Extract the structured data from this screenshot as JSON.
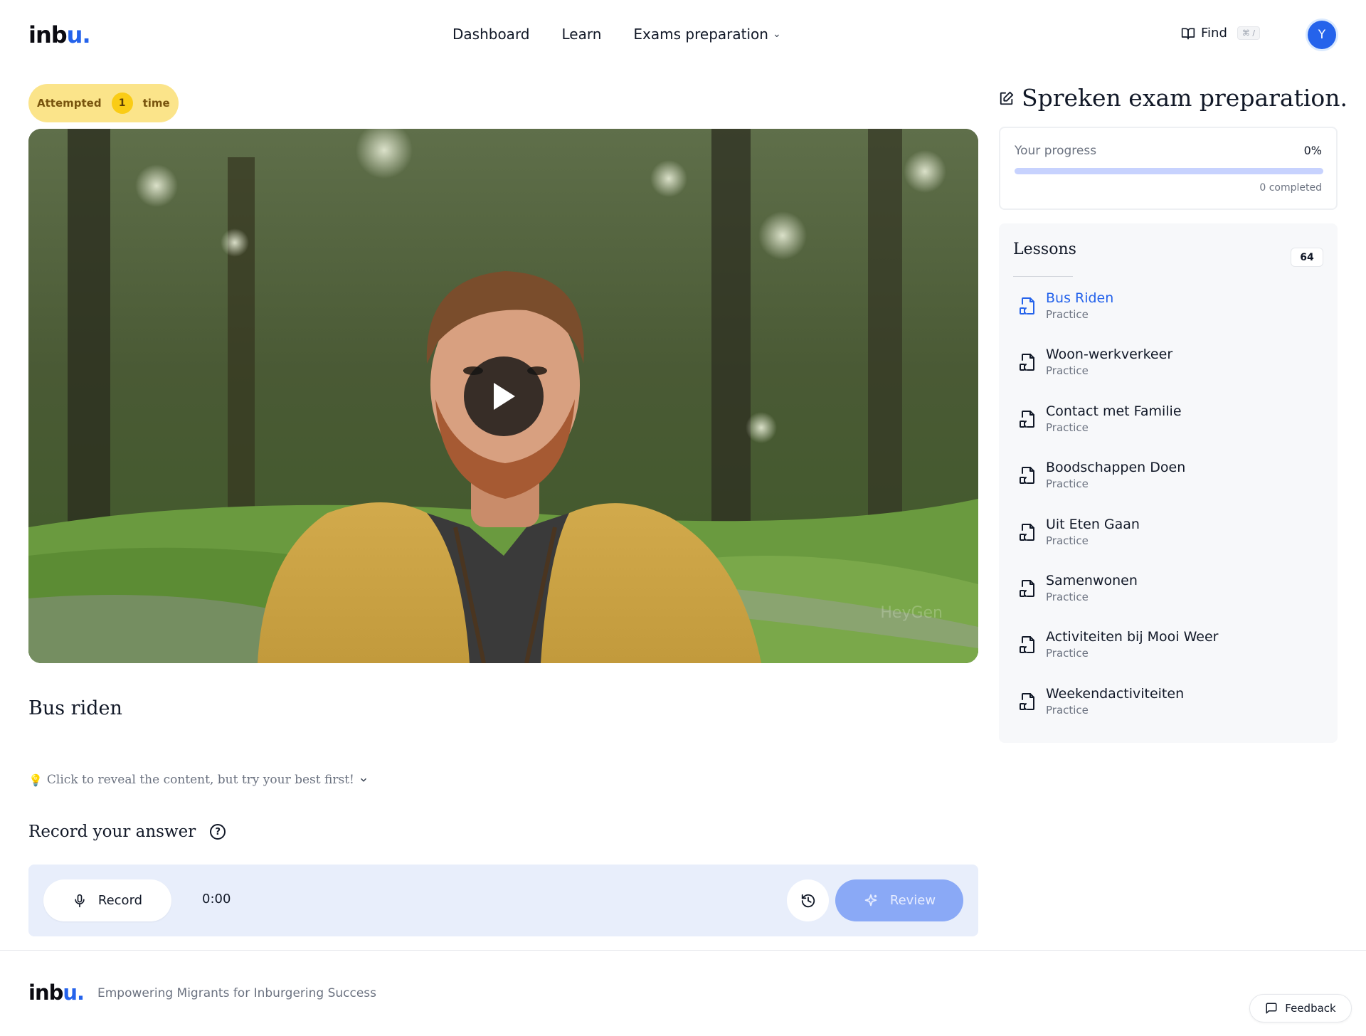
{
  "header": {
    "logo_main": "inb",
    "logo_accent": "u.",
    "nav": [
      {
        "label": "Dashboard"
      },
      {
        "label": "Learn"
      },
      {
        "label": "Exams preparation"
      }
    ],
    "find_label": "Find",
    "find_shortcut": "⌘ /",
    "avatar_initial": "Y"
  },
  "attempt": {
    "prefix": "Attempted",
    "count": "1",
    "suffix": "time"
  },
  "video": {
    "watermark": "HeyGen"
  },
  "lesson_title": "Bus riden",
  "reveal_text": "Click to reveal the content, but try your best first!",
  "record": {
    "heading": "Record your answer",
    "record_label": "Record",
    "timer": "0:00",
    "review_label": "Review"
  },
  "sidebar": {
    "title": "Spreken exam preparation.",
    "progress": {
      "label": "Your progress",
      "percent_text": "0%",
      "fraction": 0,
      "completed_text": "0 completed"
    },
    "lessons_heading": "Lessons",
    "lessons_count": "64",
    "lessons": [
      {
        "name": "Bus Riden",
        "type": "Practice",
        "active": true
      },
      {
        "name": "Woon-werkverkeer",
        "type": "Practice",
        "active": false
      },
      {
        "name": "Contact met Familie",
        "type": "Practice",
        "active": false
      },
      {
        "name": "Boodschappen Doen",
        "type": "Practice",
        "active": false
      },
      {
        "name": "Uit Eten Gaan",
        "type": "Practice",
        "active": false
      },
      {
        "name": "Samenwonen",
        "type": "Practice",
        "active": false
      },
      {
        "name": "Activiteiten bij Mooi Weer",
        "type": "Practice",
        "active": false
      },
      {
        "name": "Weekendactiviteiten",
        "type": "Practice",
        "active": false
      }
    ]
  },
  "footer": {
    "logo_main": "inb",
    "logo_accent": "u.",
    "tagline": "Empowering Migrants for Inburgering Success",
    "feedback_label": "Feedback"
  },
  "colors": {
    "accent": "#2563eb",
    "attempt_bg": "#fbe48a",
    "recorder_bg": "#e8eefb",
    "review_bg": "#8aa9f6"
  }
}
